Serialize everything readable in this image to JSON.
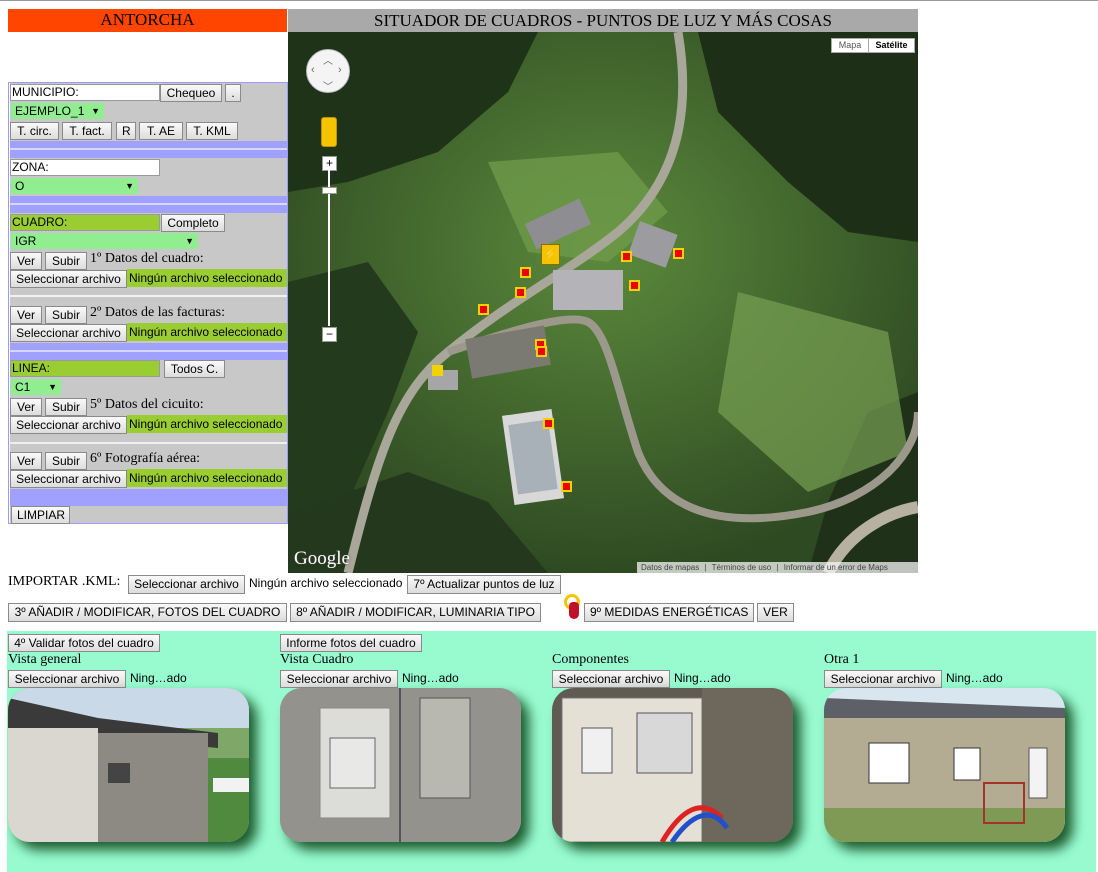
{
  "header": {
    "brand": "ANTORCHA",
    "title": "SITUADOR DE CUADROS - PUNTOS DE LUZ Y MÁS COSAS"
  },
  "colors": {
    "brand_bg": "#ff4500",
    "title_bg": "#a9a9a9",
    "panel_band": "#a0a0ff",
    "panel_bg": "#c8c8c8",
    "field_green": "#9acd32",
    "select_green": "#90ee90",
    "photo_area": "#98fbd0"
  },
  "panel": {
    "municipio_label": "MUNICIPIO:",
    "chequeo_btn": "Chequeo",
    "dot_btn": ".",
    "municipio_select": "EJEMPLO_1",
    "t_circ": "T. circ.",
    "t_fact": "T. fact.",
    "r_btn": "R",
    "t_ae": "T. AE",
    "t_kml": "T. KML",
    "zona_label": "ZONA:",
    "zona_select": "O",
    "cuadro_label": "CUADRO:",
    "completo_btn": "Completo",
    "cuadro_select": "IGR",
    "ver": "Ver",
    "subir": "Subir",
    "datos_cuadro": "1º Datos del cuadro:",
    "datos_facturas": "2º Datos de las facturas:",
    "datos_circuito": "5º Datos del cicuito:",
    "foto_aerea": "6º Fotografía aérea:",
    "file_btn": "Seleccionar archivo",
    "no_file": "Ningún archivo seleccionado",
    "linea_label": "LINEA:",
    "todos_btn": "Todos C.",
    "linea_select": "C1",
    "limpiar": "LIMPIAR"
  },
  "map": {
    "mapa_tab": "Mapa",
    "satelite_tab": "Satélite",
    "google_logo": "Google",
    "footer_datos": "Datos de mapas",
    "footer_terminos": "Términos de uso",
    "footer_error": "Informar de un error de Maps",
    "zoom_in": "+",
    "zoom_out": "−",
    "warning_icon": "⚡"
  },
  "import_row": {
    "label": "IMPORTAR .KML:",
    "file_btn": "Seleccionar archivo",
    "no_file": "Ningún archivo seleccionado",
    "actualizar": "7º Actualizar puntos de luz"
  },
  "action_row": {
    "fotos_cuadro": "3º AÑADIR / MODIFICAR, FOTOS DEL CUADRO",
    "luminaria": "8º AÑADIR / MODIFICAR, LUMINARIA TIPO",
    "medidas": "9º MEDIDAS ENERGÉTICAS",
    "ver": "VER"
  },
  "photos": {
    "validar_btn": "4º Validar fotos del cuadro",
    "informe_btn": "Informe fotos del cuadro",
    "file_btn": "Seleccionar archivo",
    "no_file_short": "Ning…ado",
    "items": [
      {
        "title": "Vista general"
      },
      {
        "title": "Vista Cuadro"
      },
      {
        "title": "Componentes"
      },
      {
        "title": "Otra 1"
      }
    ]
  }
}
